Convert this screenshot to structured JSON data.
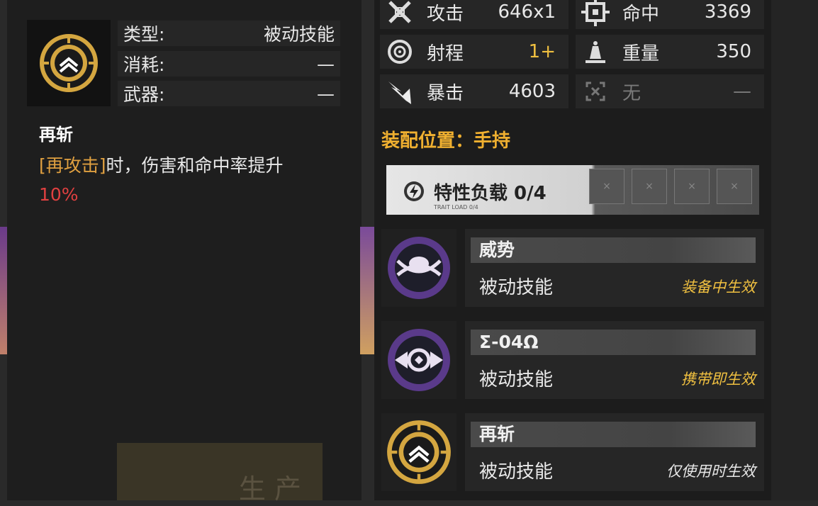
{
  "left": {
    "info": [
      {
        "label": "类型:",
        "value": "被动技能"
      },
      {
        "label": "消耗:",
        "value": "—"
      },
      {
        "label": "武器:",
        "value": "—"
      }
    ],
    "skill_name": "再斩",
    "desc_highlight": "[再攻击]",
    "desc_rest": "时，伤害和命中率提升",
    "desc_pct": "10%",
    "bg_text": "生 产"
  },
  "stats": [
    {
      "label": "攻击",
      "value": "646x1",
      "icon": "sword-icon"
    },
    {
      "label": "命中",
      "value": "3369",
      "icon": "target-icon"
    },
    {
      "label": "射程",
      "value": "1+",
      "icon": "range-icon",
      "value_color": "#f0c040"
    },
    {
      "label": "重量",
      "value": "350",
      "icon": "weight-icon"
    },
    {
      "label": "暴击",
      "value": "4603",
      "icon": "crit-icon"
    },
    {
      "label": "无",
      "value": "—",
      "icon": "empty-icon"
    }
  ],
  "equip_position": "装配位置：手持",
  "trait_load": {
    "label": "特性负载 0/4",
    "sub": "TRAIT LOAD 0/4",
    "slots": 4,
    "slot_mark": "×"
  },
  "skills": [
    {
      "name": "威势",
      "type": "被动技能",
      "condition": "装备中生效",
      "condition_color": "#f0c040",
      "icon": "purple-emblem-icon"
    },
    {
      "name": "Σ-04Ω",
      "type": "被动技能",
      "condition": "携带即生效",
      "condition_color": "#f0c040",
      "icon": "purple-eye-icon"
    },
    {
      "name": "再斩",
      "type": "被动技能",
      "condition": "仅使用时生效",
      "condition_color": "#e8e8e8",
      "icon": "gold-chevron-icon"
    }
  ],
  "colors": {
    "gold": "#d4a640",
    "purple": "#5a3a8a",
    "orange": "#f0b030",
    "red": "#e04040"
  }
}
